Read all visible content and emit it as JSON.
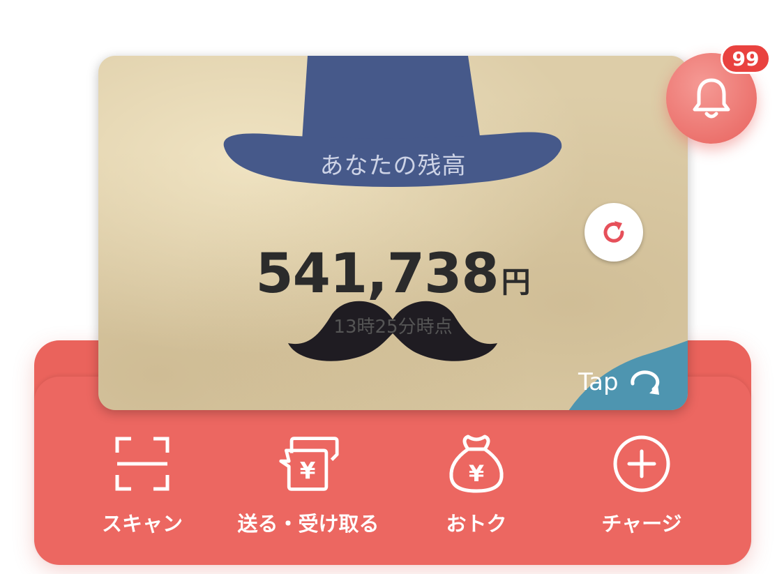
{
  "balance": {
    "label": "あなたの残高",
    "amount": "541,738",
    "currency": "円",
    "timestamp": "13時25分時点"
  },
  "card": {
    "tap_label": "Tap",
    "tap_color": "#4e95b0",
    "hat_color": "#46598a",
    "background_color": "#ddcda8"
  },
  "notifications": {
    "count": "99",
    "icon": "bell-icon"
  },
  "actions": [
    {
      "label": "スキャン",
      "icon": "scan-icon"
    },
    {
      "label": "送る・受け取る",
      "icon": "send-receive-icon"
    },
    {
      "label": "おトク",
      "icon": "money-bag-icon"
    },
    {
      "label": "チャージ",
      "icon": "plus-circle-icon"
    }
  ],
  "colors": {
    "accent": "#ec6761",
    "refresh": "#e6505a"
  }
}
